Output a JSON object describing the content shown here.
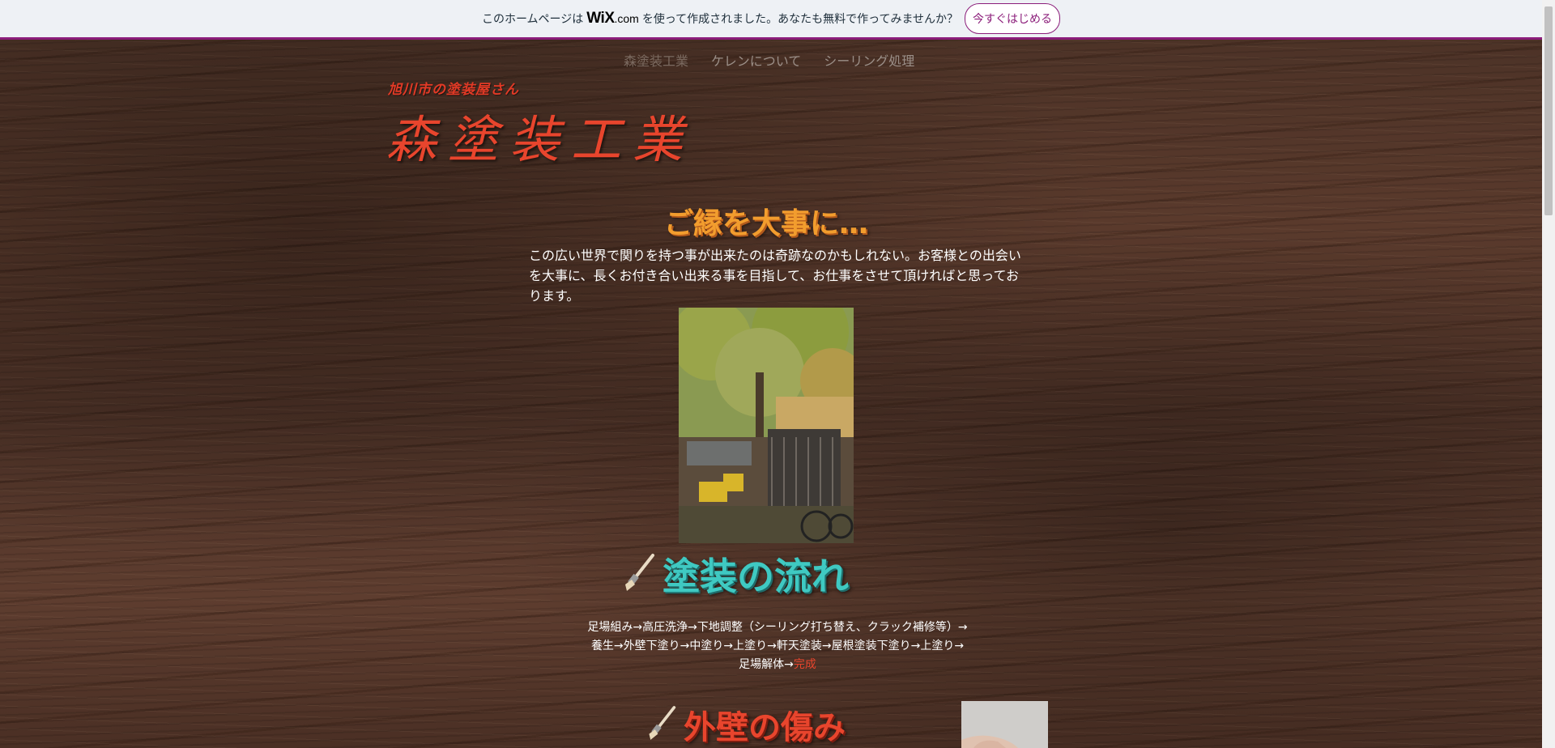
{
  "wix_banner": {
    "text_before": "このホームページは",
    "logo_main": "WiX",
    "logo_suffix": ".com",
    "text_after": "を使って作成されました。あなたも無料で作ってみませんか？",
    "cta_label": "今すぐはじめる",
    "accent_color": "#8b1d7a"
  },
  "nav": {
    "items": [
      {
        "label": "森塗装工業"
      },
      {
        "label": "ケレンについて"
      },
      {
        "label": "シーリング処理"
      }
    ]
  },
  "header": {
    "tagline": "旭川市の塗装屋さん",
    "title": "森塗装工業"
  },
  "intro": {
    "heading": "ご縁を大事に…",
    "text": "この広い世界で関りを持つ事が出来たのは奇跡なのかもしれない。お客様との出会いを大事に、長くお付き合い出来る事を目指して、お仕事をさせて頂ければと思っております。"
  },
  "flow": {
    "heading": "塗装の流れ",
    "line1": "足場組み→高圧洗浄→下地調整（シーリング打ち替え、クラック補修等）→",
    "line2": "養生→外壁下塗り→中塗り→上塗り→軒天塗装→屋根塗装下塗り→上塗り→",
    "line3_prefix": "足場解体→",
    "line3_done": "完成"
  },
  "damage": {
    "heading": "外壁の傷み"
  },
  "icons": {
    "brush": "paint-brush-icon"
  },
  "colors": {
    "title_red": "#e8452d",
    "heading_orange": "#f29d2e",
    "heading_teal": "#3fc9c2"
  }
}
